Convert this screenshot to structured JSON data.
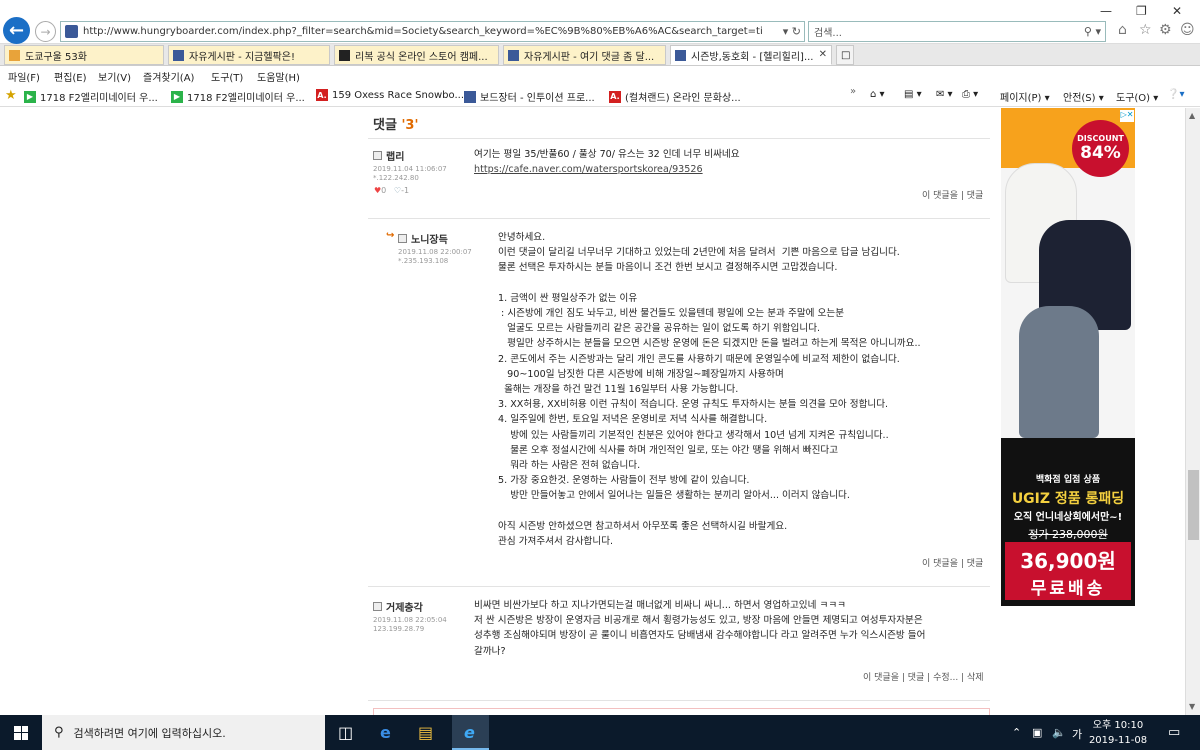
{
  "browser": {
    "url": "http://www.hungryboarder.com/index.php?_filter=search&mid=Society&search_keyword=%EC%9B%80%EB%A6%AC&search_target=title_content&page=",
    "search_placeholder": "검색...",
    "tabs": [
      {
        "label": "도쿄구울 53화",
        "active": false
      },
      {
        "label": "자유게시판 - 지금헬팍은!",
        "active": false
      },
      {
        "label": "리복 공식 온라인 스토어 캠페...",
        "active": false
      },
      {
        "label": "자유게시판 - 여기 댓글 좀 달...",
        "active": false
      },
      {
        "label": "시즌방,동호회 - [헬리힐리]...",
        "active": true
      }
    ],
    "menu": [
      "파일(F)",
      "편집(E)",
      "보기(V)",
      "즐겨찾기(A)",
      "도구(T)",
      "도움말(H)"
    ],
    "favorites": [
      {
        "label": "1718 F2엘리미네이터 우...",
        "icon": "green"
      },
      {
        "label": "1718 F2엘리미네이터 우...",
        "icon": "green"
      },
      {
        "label": "159 Oxess Race Snowbo...",
        "icon": "red"
      },
      {
        "label": "보드장터 - 인투이션 프로...",
        "icon": "blue"
      },
      {
        "label": "(컬쳐랜드) 온라인 문화상...",
        "icon": "red"
      }
    ],
    "commands": [
      "페이지(P) ▾",
      "안전(S) ▾",
      "도구(O) ▾"
    ]
  },
  "comments_section": {
    "title_prefix": "댓글",
    "count": "'3'",
    "comments": [
      {
        "author": "랩리",
        "date": "2019.11.04 11:06:07",
        "ip": "*.122.242.80",
        "votes_up": "0",
        "votes_down": "-1",
        "text": "여기는 평일 35/반풀60 / 풀상 70/ 유스는 32 인데 너무 비싸네요",
        "link": "https://cafe.naver.com/watersportskorea/93526",
        "actions": [
          "이 댓글을",
          "댓글"
        ]
      },
      {
        "author": "노니장득",
        "date": "2019.11.08 22:00:07",
        "ip": "*.235.193.108",
        "text": "안녕하세요.\n이런 댓글이 달리길 너무너무 기대하고 있었는데 2년만에 처음 달려서  기쁜 마음으로 답글 남깁니다.\n물론 선택은 투자하시는 분들 마음이니 조건 한번 보시고 결정해주시면 고맙겠습니다.\n\n1. 금액이 싼 평일상주가 없는 이유\n : 시즌방에 개인 짐도 놔두고, 비싼 물건들도 있을텐데 평일에 오는 분과 주말에 오는분\n   얼굴도 모르는 사람들끼리 같은 공간을 공유하는 일이 없도록 하기 위함입니다.\n   평일만 상주하시는 분들을 모으면 시즌방 운영에 돈은 되겠지만 돈을 벌려고 하는게 목적은 아니니까요..\n2. 콘도에서 주는 시즌방과는 달리 개인 콘도를 사용하기 때문에 운영일수에 비교적 제한이 없습니다.\n   90~100일 남짓한 다른 시즌방에 비해 개장일~폐장일까지 사용하며\n  올해는 개장을 하건 말건 11월 16일부터 사용 가능합니다.\n3. XX허용, XX비허용 이런 규칙이 적습니다. 운영 규칙도 투자하시는 분들 의견을 모아 정합니다.\n4. 일주일에 한번, 토요일 저녁은 운영비로 저녁 식사를 해결합니다.\n    방에 있는 사람들끼리 기본적인 친분은 있어야 한다고 생각해서 10년 넘게 지켜온 규칙입니다..\n    물론 오후 정설시간에 식사를 하며 개인적인 일로, 또는 야간 땡을 위해서 빠진다고\n    뭐라 하는 사람은 전혀 없습니다.\n5. 가장 중요한것. 운영하는 사람들이 전부 방에 같이 있습니다.\n    방만 만들어놓고 안에서 일어나는 일들은 생활하는 분끼리 알아서... 이러지 않습니다.\n\n아직 시즌방 안하셨으면 참고하셔서 아무쪼록 좋은 선택하시길 바랄게요.\n관심 가져주셔서 감사합니다.",
        "actions": [
          "이 댓글을",
          "댓글"
        ]
      },
      {
        "author": "거제충각",
        "date": "2019.11.08 22:05:04",
        "ip": "123.199.28.79",
        "text": "비싸면 비싼가보다 하고 지나가면되는걸 매너없게 비싸니 싸니... 하면서 영업하고있네 ㅋㅋㅋ\n저 싼 시즌방은 방장이 운영자금 비공개로 해서 횡령가능성도 있고, 방장 마음에 안들면 제명되고 여성투자자분은\n성추행 조심해야되며 방장이 곧 룰이니 비흡연자도 담배냄새 감수해야합니다 라고 알려주면 누가 익스시즌방 들어\n갈까나?",
        "actions": [
          "이 댓글을",
          "댓글",
          "수정...",
          "삭제"
        ]
      }
    ]
  },
  "ad": {
    "discount_label": "DISCOUNT",
    "discount_value": "84%",
    "line1": "백화점 입점 상품",
    "line2": "UGIZ 정품 롱패딩",
    "line3": "오직 언니네상회에서만~!",
    "original_price": "정가 238,000원",
    "price": "36,900원",
    "shipping": "무료배송"
  },
  "taskbar": {
    "search_placeholder": "검색하려면 여기에 입력하십시오.",
    "time": "오후 10:10",
    "date": "2019-11-08"
  }
}
